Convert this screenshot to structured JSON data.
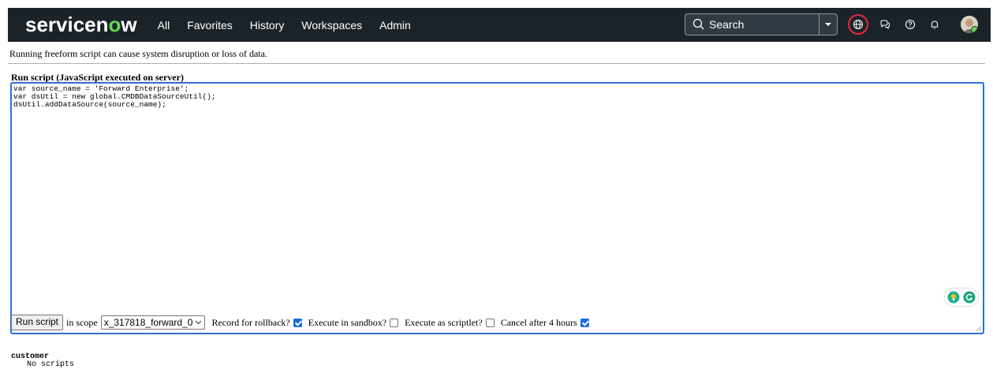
{
  "app": {
    "logo_prefix": "servicen",
    "logo_o": "o",
    "logo_suffix": "w"
  },
  "nav": {
    "items": [
      "All",
      "Favorites",
      "History",
      "Workspaces",
      "Admin"
    ]
  },
  "search": {
    "placeholder": "Search"
  },
  "topbar_icons": [
    "globe-icon",
    "chat-icon",
    "help-icon",
    "bell-icon"
  ],
  "colors": {
    "topbar": "#1b2329",
    "brand_green": "#62d84e",
    "editor_focus": "#2e6fd1",
    "globe_ring": "#e5293f",
    "checkbox_checked": "#1a6fe0"
  },
  "warning": "Running freeform script can cause system disruption or loss of data.",
  "editor": {
    "title": "Run script (JavaScript executed on server)",
    "lines": [
      "var source_name = 'Forward Enterprise';",
      "var dsUtil = new global.CMDBDataSourceUtil();",
      "dsUtil.addDataSource(source_name);"
    ]
  },
  "controls": {
    "run_button": "Run script",
    "in_scope_label": "in scope",
    "scope_value": "x_317818_forward_0",
    "record_rollback_label": "Record for rollback?",
    "record_rollback_checked": true,
    "sandbox_label": "Execute in sandbox?",
    "sandbox_checked": false,
    "scriptlet_label": "Execute as scriptlet?",
    "scriptlet_checked": false,
    "cancel_label": "Cancel after 4 hours",
    "cancel_checked": true
  },
  "results": {
    "scope_name": "customer",
    "message": "No scripts"
  }
}
